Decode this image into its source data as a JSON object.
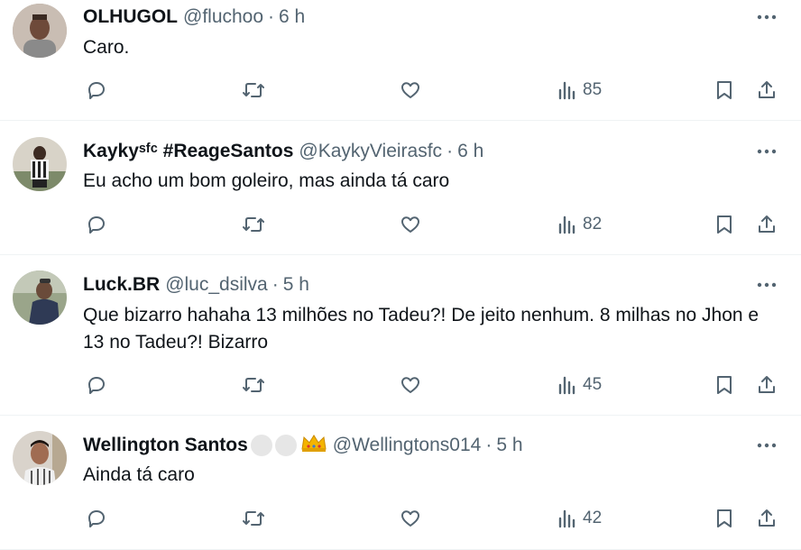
{
  "tweets": [
    {
      "name": "OLHUGOL",
      "handle": "@fluchoo",
      "separator": "·",
      "time": "6 h",
      "text": "Caro.",
      "views": "85",
      "avatar_icon": "avatar-photo-icon"
    },
    {
      "name": "Kaykyˢᶠᶜ #ReageSantos",
      "handle": "@KaykyVieirasfc",
      "separator": "·",
      "time": "6 h",
      "text": "Eu acho um bom goleiro, mas ainda tá caro",
      "views": "82",
      "avatar_icon": "avatar-photo-icon"
    },
    {
      "name": "Luck.BR",
      "handle": "@luc_dsilva",
      "separator": "·",
      "time": "5 h",
      "text": "Que bizarro hahaha 13 milhões no Tadeu?! De jeito nenhum. 8 milhas no Jhon e 13 no Tadeu?! Bizarro",
      "views": "45",
      "avatar_icon": "avatar-photo-icon"
    },
    {
      "name": "Wellington Santos",
      "handle": "@Wellingtons014",
      "separator": "·",
      "time": "5 h",
      "text": "Ainda tá caro",
      "views": "42",
      "avatar_icon": "avatar-photo-icon",
      "name_emojis": [
        "white-circle-emoji",
        "white-circle-emoji",
        "crown-emoji"
      ]
    }
  ],
  "colors": {
    "text_primary": "#0f1419",
    "text_secondary": "#536471",
    "divider": "#eff3f4"
  },
  "icons": [
    "more-icon",
    "reply-icon",
    "retweet-icon",
    "like-icon",
    "views-icon",
    "bookmark-icon",
    "share-icon"
  ]
}
